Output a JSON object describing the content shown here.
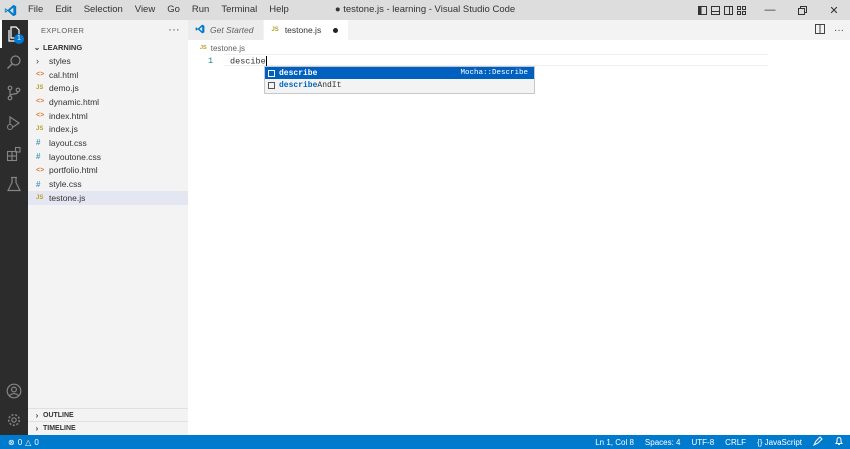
{
  "titlebar": {
    "title": "● testone.js - learning - Visual Studio Code",
    "menu": [
      "File",
      "Edit",
      "Selection",
      "View",
      "Go",
      "Run",
      "Terminal",
      "Help"
    ]
  },
  "activity": {
    "explorer_badge": "1"
  },
  "sidebar": {
    "header": "EXPLORER",
    "more": "···",
    "folder": "LEARNING",
    "items": [
      {
        "label": "styles",
        "icon": "folder-chevron"
      },
      {
        "label": "cal.html",
        "icon": "html-icon"
      },
      {
        "label": "demo.js",
        "icon": "js-icon"
      },
      {
        "label": "dynamic.html",
        "icon": "html-icon"
      },
      {
        "label": "index.html",
        "icon": "html-icon"
      },
      {
        "label": "index.js",
        "icon": "js-icon"
      },
      {
        "label": "layout.css",
        "icon": "css-icon"
      },
      {
        "label": "layoutone.css",
        "icon": "css-icon"
      },
      {
        "label": "portfolio.html",
        "icon": "html-icon"
      },
      {
        "label": "style.css",
        "icon": "css-icon"
      },
      {
        "label": "testone.js",
        "icon": "js-icon"
      }
    ],
    "outline": "OUTLINE",
    "timeline": "TIMELINE"
  },
  "tabs": [
    {
      "label": "Get Started"
    },
    {
      "label": "testone.js"
    }
  ],
  "breadcrumb": "testone.js",
  "icons": {
    "js": "JS",
    "html": "<>",
    "css": "#"
  },
  "editor": {
    "line_number": "1",
    "code": "descibe"
  },
  "suggestions": [
    {
      "match": "describe",
      "rest": "",
      "detail": "Mocha::Describe"
    },
    {
      "match": "describe",
      "rest": "AndIt",
      "detail": ""
    }
  ],
  "status": {
    "errors": "0",
    "warnings": "0",
    "position": "Ln 1, Col 8",
    "spaces": "Spaces: 4",
    "encoding": "UTF-8",
    "eol": "CRLF",
    "language": "JavaScript"
  },
  "colors": {
    "accent": "#007acc",
    "activitybar": "#2c2c2c",
    "suggest_selected": "#0060c0"
  }
}
